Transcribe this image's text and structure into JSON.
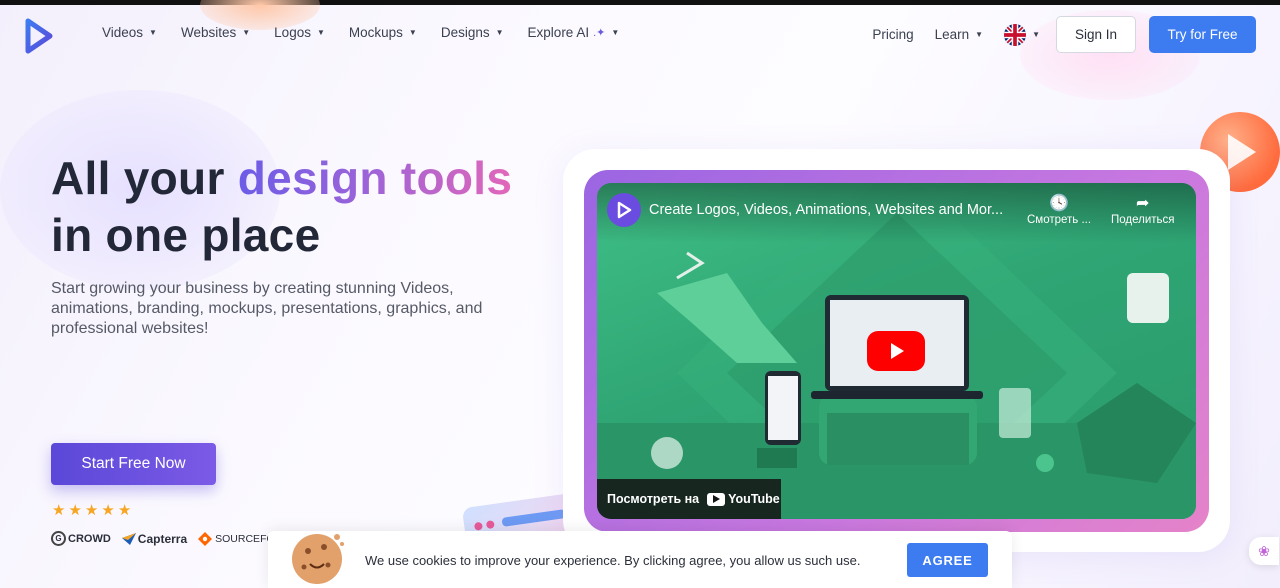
{
  "nav": {
    "menu": [
      {
        "label": "Videos"
      },
      {
        "label": "Websites"
      },
      {
        "label": "Logos"
      },
      {
        "label": "Mockups"
      },
      {
        "label": "Designs"
      },
      {
        "label": "Explore AI"
      }
    ],
    "pricing": "Pricing",
    "learn": "Learn",
    "sign_in": "Sign In",
    "try_free": "Try for Free"
  },
  "hero": {
    "title_part1": "All your ",
    "title_highlight": "design tools",
    "title_part2": "in one place",
    "subtitle": "Start growing your business by creating stunning Videos, animations, branding, mockups, presentations, graphics, and professional websites!",
    "cta": "Start Free Now",
    "rating_stars": 5,
    "review_sites": [
      "CROWD",
      "Capterra",
      "SOURCEFOR"
    ]
  },
  "video": {
    "title": "Create Logos, Videos, Animations, Websites and Mor...",
    "watch_later": "Смотреть ...",
    "share": "Поделиться",
    "watch_on": "Посмотреть на",
    "youtube": "YouTube"
  },
  "cookie": {
    "text": "We use cookies to improve your experience. By clicking agree, you allow us such use.",
    "agree": "AGREE"
  },
  "colors": {
    "primary": "#3d7bf0",
    "cta_purple": "#5b48d8",
    "video_green": "#2fa574"
  }
}
